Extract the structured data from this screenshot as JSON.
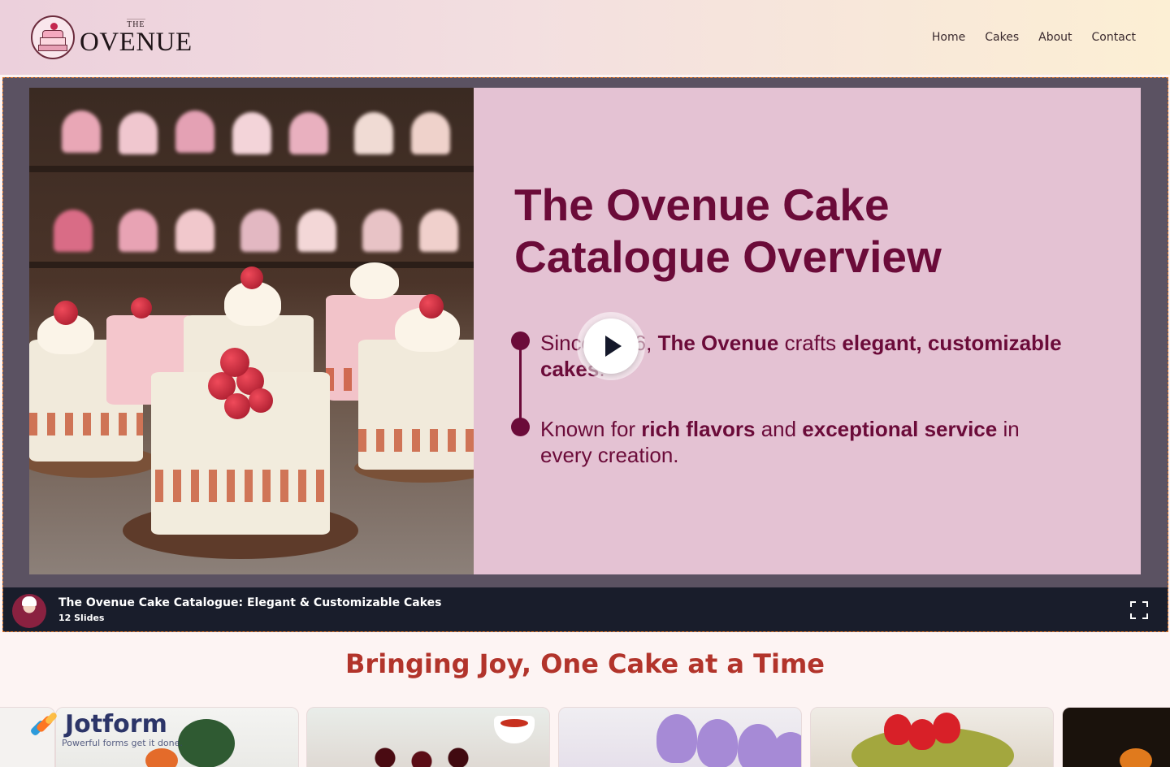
{
  "header": {
    "logo_small": "THE",
    "logo_name": "OVENUE",
    "nav": [
      "Home",
      "Cakes",
      "About",
      "Contact"
    ]
  },
  "slide": {
    "title": "The Ovenue Cake Catalogue Overview",
    "bullet1": {
      "p1": "Since 2016, ",
      "b1": "The Ovenue",
      "p2": " crafts ",
      "b2": "elegant, customizable cakes",
      "p3": "."
    },
    "bullet2": {
      "p1": "Known for ",
      "b1": "rich flavors",
      "p2": " and ",
      "b2": "exceptional service",
      "p3": " in every creation."
    }
  },
  "player": {
    "title": "The Ovenue Cake Catalogue: Elegant & Customizable Cakes",
    "slides_count": "12 Slides"
  },
  "section": {
    "title": "Bringing Joy, One Cake at a Time"
  },
  "jotform": {
    "name": "Jotform",
    "tagline": "Powerful forms get it done."
  },
  "colors": {
    "brand_dark": "#6b0b39",
    "panel": "#e4c2d3",
    "section_title": "#b2342b",
    "player_bar": "#191d2b"
  }
}
